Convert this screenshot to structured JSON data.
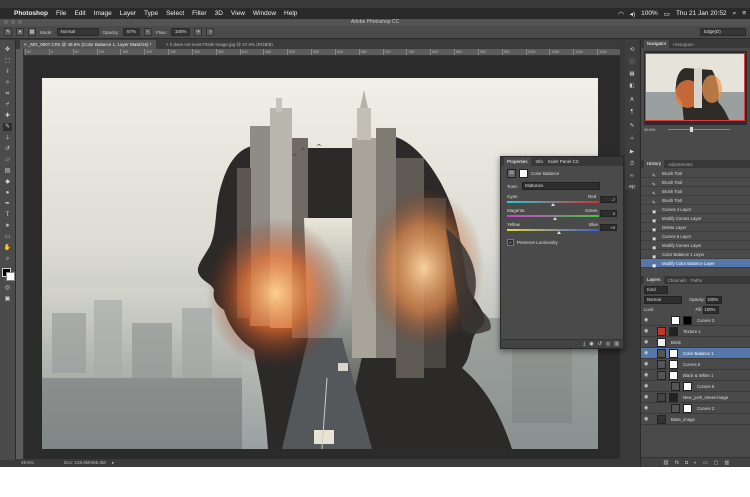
{
  "menubar": {
    "app": "Photoshop",
    "items": [
      "File",
      "Edit",
      "Image",
      "Layer",
      "Type",
      "Select",
      "Filter",
      "3D",
      "View",
      "Window",
      "Help"
    ],
    "battery": "100%",
    "clock": "Thu 21 Jan  20:52"
  },
  "titlebar": {
    "title": "Adobe Photoshop CC"
  },
  "options": {
    "mode_label": "Mode:",
    "mode_value": "Normal",
    "opacity_label": "Opacity:",
    "opacity_value": "57%",
    "flow_label": "Flow:",
    "flow_value": "100%",
    "workspace": "Edge(D)"
  },
  "doctabs": {
    "active": "_MG_0607.CR2 @ 49.5% (Color Balance 1, Layer Mask/16) *",
    "second": "it does not exist Fitsile Image.jpg @ 47.6% (RGB/8)"
  },
  "ruler_ticks": [
    "50",
    "0",
    "50",
    "100",
    "150",
    "200",
    "250",
    "300",
    "350",
    "400",
    "450",
    "500",
    "550",
    "600",
    "650",
    "700",
    "750",
    "800",
    "850",
    "900",
    "950",
    "1000",
    "1050",
    "1100",
    "1150"
  ],
  "status": {
    "zoom": "49.5%",
    "doc": "Doc: 126.9M/465.3M"
  },
  "properties": {
    "tabs": [
      "Properties",
      "Info",
      "Kuler Panel CC"
    ],
    "title": "Color Balance",
    "tone_label": "Tone:",
    "tone_value": "Midtones",
    "sliders": [
      {
        "left": "Cyan",
        "right": "Red",
        "value": "-7"
      },
      {
        "left": "Magenta",
        "right": "Green",
        "value": "0"
      },
      {
        "left": "Yellow",
        "right": "Blue",
        "value": "+9"
      }
    ],
    "preserve": "Preserve Luminosity"
  },
  "navigator": {
    "tabs": [
      "Navigator",
      "Histogram"
    ],
    "zoom": "49.5%"
  },
  "history": {
    "tabs": [
      "History",
      "Adjustments"
    ],
    "items": [
      "Brush Tool",
      "Brush Tool",
      "Brush Tool",
      "Brush Tool",
      "Curves 4 Layer",
      "Modify Curves Layer",
      "Delete Layer",
      "Curves 6 Layer",
      "Modify Curves Layer",
      "Color Balance 1 Layer",
      "Modify Color Balance Layer"
    ]
  },
  "layers": {
    "tabs": [
      "Layers",
      "Channels",
      "Paths"
    ],
    "kind": "Kind",
    "blend": "Normal",
    "opacity_label": "Opacity:",
    "opacity_value": "100%",
    "lock_label": "Lock:",
    "fill_label": "Fill:",
    "fill_value": "100%",
    "items": [
      "Curves 3",
      "Texture 1",
      "Birds",
      "Color Balance 1",
      "Curves 6",
      "Black & White 1",
      "Curves 5",
      "New_york_street.image",
      "Curves 2",
      "Base_image"
    ]
  },
  "colors": {
    "accent": "#5577aa",
    "nav_frame": "#e43a3a"
  }
}
